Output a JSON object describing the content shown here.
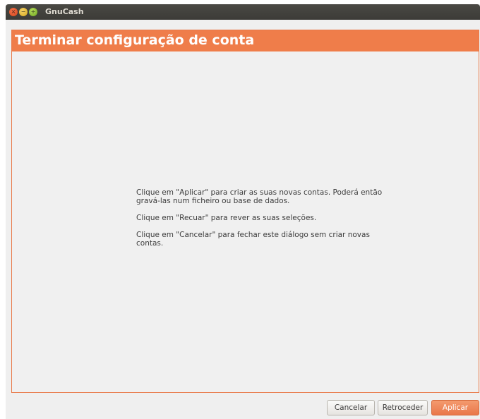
{
  "window": {
    "title": "GnuCash",
    "controls": [
      "close-icon",
      "minimize-icon",
      "maximize-icon"
    ]
  },
  "page": {
    "heading": "Terminar configuração de conta",
    "paragraphs": [
      "Clique em \"Aplicar\" para criar as suas novas contas. Poderá então gravá-las num ficheiro ou base de dados.",
      "Clique em \"Recuar\" para rever as suas seleções.",
      "Clique em \"Cancelar\" para fechar este diálogo sem criar novas contas."
    ]
  },
  "buttons": {
    "cancel": "Cancelar",
    "back": "Retroceder",
    "apply": "Aplicar"
  },
  "colors": {
    "accent": "#ef7d4a",
    "titlebar": "#3c3b37",
    "background": "#efefef"
  }
}
